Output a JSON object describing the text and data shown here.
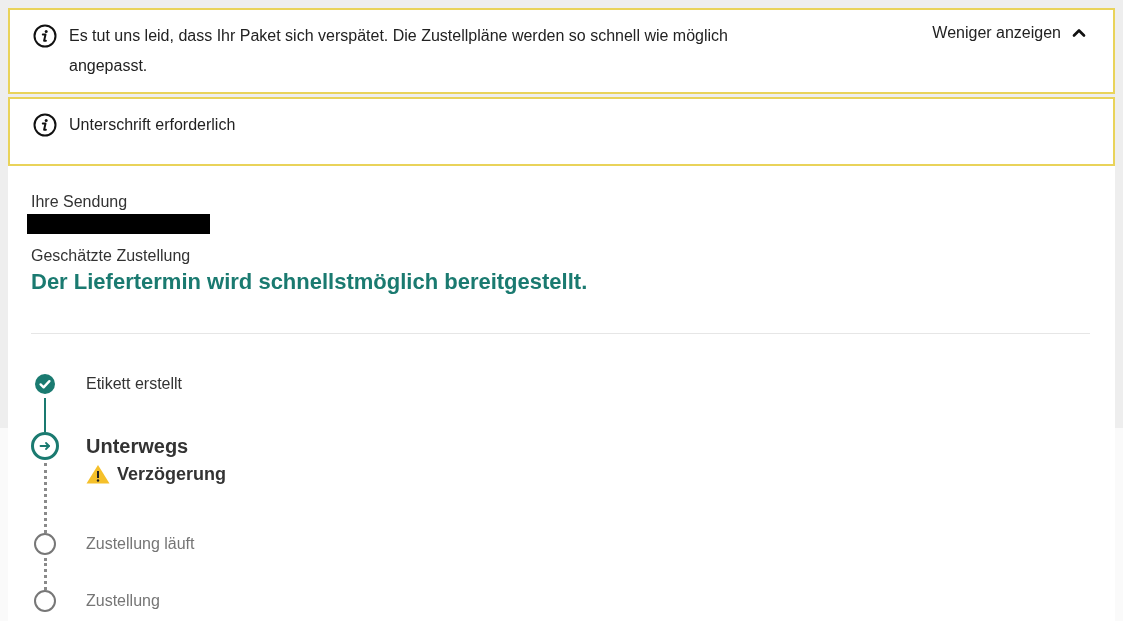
{
  "alerts": [
    {
      "kind": "info",
      "message": "Es tut uns leid, dass Ihr Paket sich verspätet. Die Zustellpläne werden so schnell wie möglich angepasst.",
      "toggle": {
        "label": "Weniger anzeigen",
        "expanded": true
      }
    },
    {
      "kind": "info",
      "message": "Unterschrift erforderlich"
    }
  ],
  "shipment": {
    "label": "Ihre Sendung",
    "delivery_label": "Geschätzte Zustellung",
    "delivery_value": "Der Liefertermin wird schnellstmöglich bereitgestellt."
  },
  "timeline": [
    {
      "label": "Etikett erstellt",
      "kind": "done"
    },
    {
      "label": "Unterwegs",
      "kind": "current",
      "warning": "Verzögerung"
    },
    {
      "label": "Zustellung läuft",
      "kind": "pending"
    },
    {
      "label": "Zustellung",
      "kind": "pending"
    }
  ]
}
